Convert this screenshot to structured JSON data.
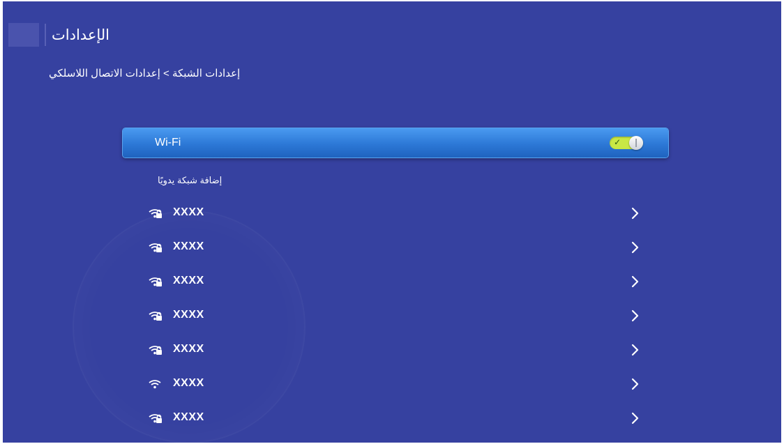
{
  "header": {
    "title": "الإعدادات"
  },
  "breadcrumb": "إعدادات الشبكة > إعدادات الاتصال اللاسلكي",
  "wifi_toggle": {
    "label": "Wi-Fi",
    "state": "on",
    "check_glyph": "✓"
  },
  "add_network_label": "إضافة شبكة يدويًا",
  "networks": [
    {
      "name": "XXXX",
      "secured": true
    },
    {
      "name": "XXXX",
      "secured": true
    },
    {
      "name": "XXXX",
      "secured": true
    },
    {
      "name": "XXXX",
      "secured": true
    },
    {
      "name": "XXXX",
      "secured": true
    },
    {
      "name": "XXXX",
      "secured": false
    },
    {
      "name": "XXXX",
      "secured": true
    }
  ],
  "icons": {
    "network_secured": "wifi-lock-icon",
    "network_open": "wifi-icon",
    "row_arrow": "chevron-right-icon"
  },
  "colors": {
    "background": "#3641a0",
    "selected_row": "#2c78d6",
    "switch_on": "#c9e845",
    "text": "#ffffff"
  }
}
